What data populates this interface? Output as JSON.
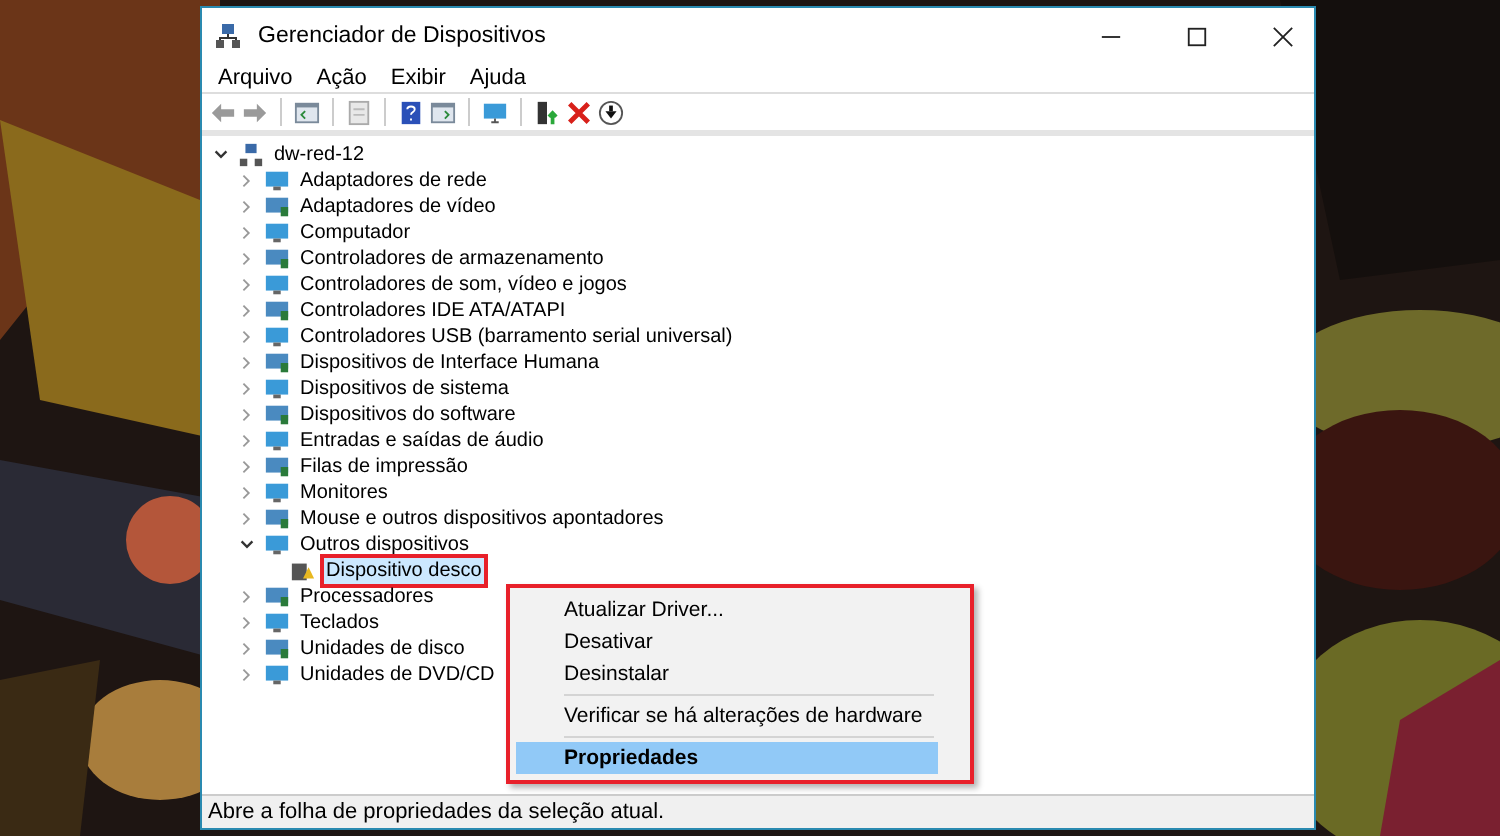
{
  "window": {
    "title": "Gerenciador de Dispositivos"
  },
  "menu_bar": [
    "Arquivo",
    "Ação",
    "Exibir",
    "Ajuda"
  ],
  "tree": [
    {
      "label": "dw-red-12",
      "expanded": true,
      "selected": false,
      "annotated": false,
      "children": [
        {
          "label": "Adaptadores de rede",
          "expanded": false,
          "selected": false,
          "annotated": false
        },
        {
          "label": "Adaptadores de vídeo",
          "expanded": false,
          "selected": false,
          "annotated": false
        },
        {
          "label": "Computador",
          "expanded": false,
          "selected": false,
          "annotated": false
        },
        {
          "label": "Controladores de armazenamento",
          "expanded": false,
          "selected": false,
          "annotated": false
        },
        {
          "label": "Controladores de som, vídeo e jogos",
          "expanded": false,
          "selected": false,
          "annotated": false
        },
        {
          "label": "Controladores IDE ATA/ATAPI",
          "expanded": false,
          "selected": false,
          "annotated": false
        },
        {
          "label": "Controladores USB (barramento serial universal)",
          "expanded": false,
          "selected": false,
          "annotated": false
        },
        {
          "label": "Dispositivos de Interface Humana",
          "expanded": false,
          "selected": false,
          "annotated": false
        },
        {
          "label": "Dispositivos de sistema",
          "expanded": false,
          "selected": false,
          "annotated": false
        },
        {
          "label": "Dispositivos do software",
          "expanded": false,
          "selected": false,
          "annotated": false
        },
        {
          "label": "Entradas e saídas de áudio",
          "expanded": false,
          "selected": false,
          "annotated": false
        },
        {
          "label": "Filas de impressão",
          "expanded": false,
          "selected": false,
          "annotated": false
        },
        {
          "label": "Monitores",
          "expanded": false,
          "selected": false,
          "annotated": false
        },
        {
          "label": "Mouse e outros dispositivos apontadores",
          "expanded": false,
          "selected": false,
          "annotated": false
        },
        {
          "label": "Outros dispositivos",
          "expanded": true,
          "selected": false,
          "annotated": false,
          "children": [
            {
              "label": "Dispositivo desco",
              "selected": true,
              "annotated": true
            }
          ]
        },
        {
          "label": "Processadores",
          "expanded": false,
          "selected": false,
          "annotated": false
        },
        {
          "label": "Teclados",
          "expanded": false,
          "selected": false,
          "annotated": false
        },
        {
          "label": "Unidades de disco",
          "expanded": false,
          "selected": false,
          "annotated": false
        },
        {
          "label": "Unidades de DVD/CD",
          "expanded": false,
          "selected": false,
          "annotated": false
        }
      ]
    }
  ],
  "context_menu": {
    "annotated": true,
    "items": [
      {
        "kind": "item",
        "label": "Atualizar Driver...",
        "selected": false,
        "default": false
      },
      {
        "kind": "item",
        "label": "Desativar",
        "selected": false,
        "default": false
      },
      {
        "kind": "item",
        "label": "Desinstalar",
        "selected": false,
        "default": false
      },
      {
        "kind": "separator"
      },
      {
        "kind": "item",
        "label": "Verificar se há alterações de hardware",
        "selected": false,
        "default": false
      },
      {
        "kind": "separator"
      },
      {
        "kind": "item",
        "label": "Propriedades",
        "selected": true,
        "default": true
      }
    ]
  },
  "status_bar": "Abre a folha de propriedades da seleção atual."
}
